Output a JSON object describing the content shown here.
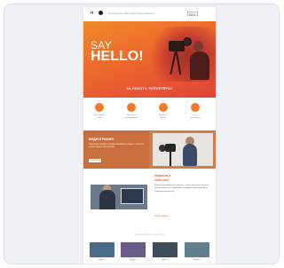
{
  "header": {
    "logo_text": "Ц",
    "nav_links": "Обучение  Курсы  Мастерская  Проекты  Контакты",
    "cta_label": "Войти"
  },
  "hero": {
    "line1": "SAY",
    "line2": "HELLO!",
    "tagline": "ЗА РАБОТУ, РЕПОРТЁРЫ!"
  },
  "features": [
    {
      "text": "Курсы видео-\nсъёмки"
    },
    {
      "text": "Монтаж и\nпостпродакшн"
    },
    {
      "text": "Работа со\nзвуком"
    },
    {
      "text": "Свет и\nпостановка"
    }
  ],
  "promo": {
    "title": "ВИДЕОГРАФИЯ",
    "text": "Научитесь снимать профессиональное видео с нуля на курсах нашей мастерской.",
    "button": "Подробнее"
  },
  "article": {
    "title": "Новости и\nсобытия",
    "body": "Наши выпускники рассказывают о своих проектах и делятся опытом работы на съёмочной площадке. Присоединяйтесь к нашему сообществу.",
    "link": "Читать далее →"
  },
  "gallery": {
    "title": "Наши работы и проекты",
    "items": [
      {
        "label": "Проект 1",
        "color": "#4a6b88"
      },
      {
        "label": "Проект 2",
        "color": "#6a5a8a"
      },
      {
        "label": "Проект 3",
        "color": "#3c4c5c"
      },
      {
        "label": "Проект 4",
        "color": "#5f7f8f"
      }
    ]
  },
  "colors": {
    "accent": "#f07b2a",
    "hero_start": "#f28a2a",
    "hero_end": "#e0443a",
    "promo": "#c96f3d"
  }
}
